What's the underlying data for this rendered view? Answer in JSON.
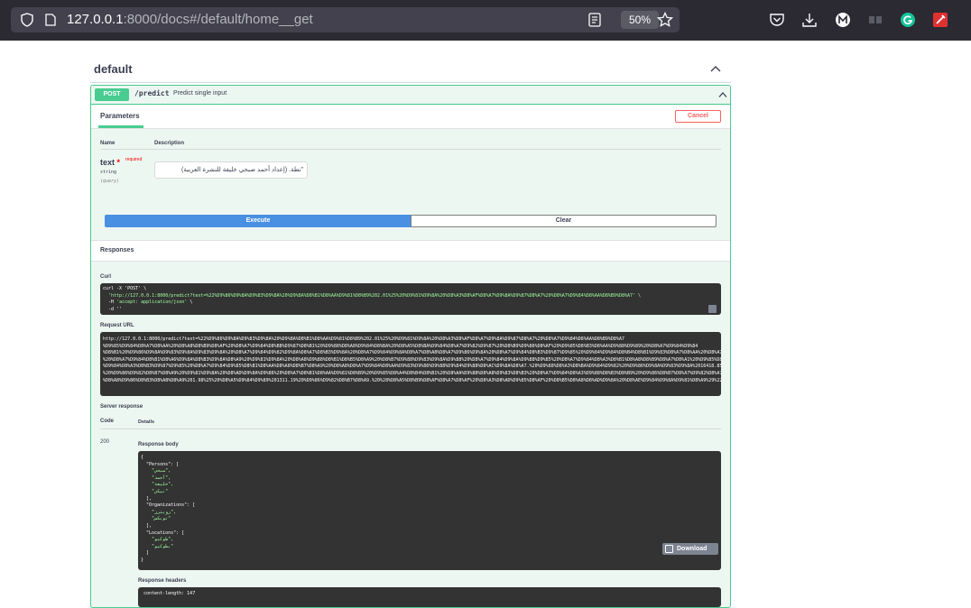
{
  "browser": {
    "url_host": "127.0.0.1",
    "url_rest": ":8000/docs#/default/home__get",
    "zoom": "50%"
  },
  "section": {
    "title": "default"
  },
  "operation": {
    "method": "POST",
    "path": "/predict",
    "summary": "Predict single input",
    "parameters_tab": "Parameters",
    "cancel_label": "Cancel",
    "col_name": "Name",
    "col_description": "Description",
    "param": {
      "name": "text",
      "required_star": "*",
      "required_label": "required",
      "type": "string",
      "in": "(query)",
      "value": "\"نطة. (إعداد أحمد صبحي خليفة للنشرة العربية)"
    },
    "execute_label": "Execute",
    "clear_label": "Clear"
  },
  "responses": {
    "title": "Responses",
    "curl_label": "Curl",
    "curl_line1": "curl -X 'POST' \\",
    "curl_line2": "  'http://127.0.0.1:8000/predict?text=%22%D9%86%D9%8A%D9%83%D9%8A%20%D9%8A%D8%B1%D8%AA%D9%81%D8%B9%202.01%25%20%D9%81%D9%8A%20%D8%A3%D8%AF%D8%A7%D9%8A%D9%87%D8%A7%20%D8%A7%D9%84%D8%AA%D8%B9%D8%A7' \\",
    "curl_line3": "  -H 'accept: application/json' \\",
    "curl_line4": "  -d ''",
    "request_url_label": "Request URL",
    "request_url_lines": [
      "http://127.0.0.1:8000/predict?text=%22%D9%86%D9%8A%D9%83%D9%8A%20%D9%8A%D8%B1%D8%AA%D9%81%D8%B9%202.01%25%20%D9%81%D9%8A%20%D8%A3%D8%AF%D8%A7%D9%8A%D9%87%D8%A7%20%D8%A7%D9%84%D8%AA%D8%B9%D8%A7",
      "%D9%85%D9%84%D8%A7%D8%AA%20%D8%A8%D8%B9%D8%AF%20%D8%A7%D9%84%D8%B8%D9%87%D8%B1%20%D9%88%D8%A8%D9%84%D8%BA%20%D8%A5%D8%BA%D9%84%D8%A7%D9%82%D9%87%20%D8%B9%D9%86%D8%AF%20%D9%85%D8%B3%D8%AA%D9%88%D9%89%20%D8%A7%D9%84%D9%84",
      "%D8%B1%20%D9%86%D9%8A%D9%83%D9%8A%D9%83%D9%8A%20%D8%A7%D9%84%D9%82%D9%8A%D8%A7%D8%B3%D9%8A%20%D8%A7%D9%84%D9%8A%D8%A7%D8%A8%D8%A7%D9%86%D9%8A%20%D8%A7%D9%84%D8%B3%D9%87%D9%85%20%D9%84%D9%84%D8%B4%D8%B1%D9%83%D8%A7%D8%AA%20%D8%A7%D9%84%D8%B9",
      "%20%D8%A7%D9%84%D8%B1%D8%A6%D9%8A%D8%B3%D9%8A%D8%A9%20%D9%81%D9%8A%20%D8%A8%D9%88%D8%B1%D8%B5%D8%A9%20%D8%B7%D9%88%D9%83%D9%8A%D9%88%20%D8%A7%D9%84%D9%8A%D9%88%D9%85%20%D8%A7%D9%84%D8%A3%D8%B1%D8%A8%D8%B9%D8%A7%D8%A1%20%D9%85%D8%B3%D8%AA%D9%81%D9%8A%D8%AF%D8%A7",
      "%D9%84%D8%A3%D8%B3%D9%87%D9%85%20%D8%A7%D9%84%D9%85%D8%B1%D8%AA%D8%A8%D8%B7%D8%A9%20%D8%A8%D8%A7%D9%84%D8%AA%D9%83%D9%86%D9%88%D9%84%D9%88%D8%AC%D9%8A%D8%A7.%20%D9%88%D8%A3%D8%BA%D9%84%D9%82%20%D9%86%D9%8A%D9%83%D9%8A%2016418.85",
      "%20%D9%86%D9%82%D8%B7%D8%A9%20%D9%81%D9%8A%20%D8%AD%D9%8A%D9%86%20%D8%A7%D8%B1%D8%AA%D9%81%D8%B9%20%D9%85%D8%A4%D8%B4%D8%B1%20%D8%AA%D9%88%D8%A8%D9%83%D8%B3%20%D8%A7%D9%84%D8%A3%D9%88%D8%B3%D8%B9%20%D9%86%D8%B7%D8%A7%D9%82%D8%A7",
      "%D8%A8%D9%86%D8%B3%D8%A8%D8%A9%201.98%25%20%D8%A5%D9%84%D9%89%201311.19%20%D9%86%D9%82%D8%B7%D8%A9.%20%28%D8%A5%D8%B9%D8%AF%D8%A7%D8%AF%20%D8%A3%D8%AD%D9%85%D8%AF%20%D8%B5%D8%A8%D8%AD%D9%8A%20%D8%AE%D9%84%D9%8A%D9%81%D8%A9%29%22"
    ],
    "server_response_label": "Server response",
    "code_header": "Code",
    "details_header": "Details",
    "status_code": "200",
    "response_body_label": "Response body",
    "body_lines": [
      {
        "t": "{",
        "c": "kw"
      },
      {
        "t": "  \"Persons\": [",
        "c": "kw"
      },
      {
        "t": "    \"صبحي\",",
        "c": "str"
      },
      {
        "t": "    \"أحمد\",",
        "c": "str"
      },
      {
        "t": "    \"خليفة\",",
        "c": "str"
      },
      {
        "t": "    \"نيكي\"",
        "c": "str"
      },
      {
        "t": "  ],",
        "c": "kw"
      },
      {
        "t": "  \"Organizations\": [",
        "c": "kw"
      },
      {
        "t": "    \"رويترز\",",
        "c": "str"
      },
      {
        "t": "    \"توبكس\"",
        "c": "str"
      },
      {
        "t": "  ],",
        "c": "kw"
      },
      {
        "t": "  \"Locations\": [",
        "c": "kw"
      },
      {
        "t": "    \"طوكيو\",",
        "c": "str"
      },
      {
        "t": "    \"بطوكيو\"",
        "c": "str"
      },
      {
        "t": "  ]",
        "c": "kw"
      },
      {
        "t": "}",
        "c": "kw"
      }
    ],
    "download_label": "Download",
    "response_headers_label": "Response headers",
    "header_first_line": " content-length: 147 "
  }
}
